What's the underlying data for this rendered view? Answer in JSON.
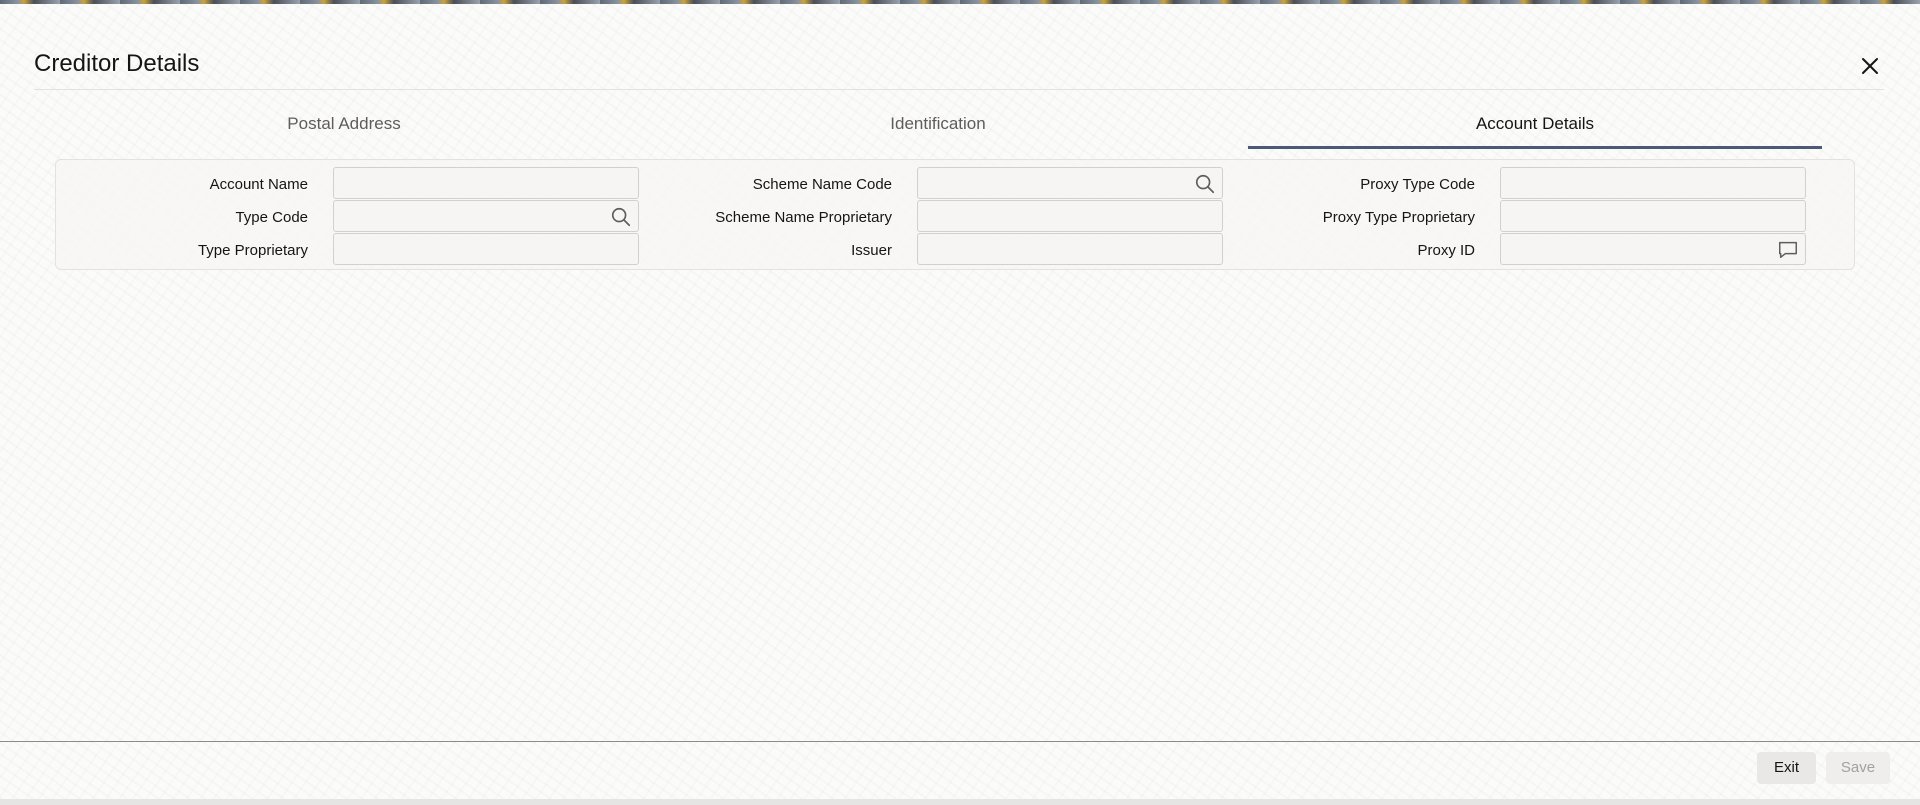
{
  "dialog": {
    "title": "Creditor Details",
    "close_icon": "close-icon"
  },
  "tabs": [
    {
      "label": "Postal Address",
      "active": false
    },
    {
      "label": "Identification",
      "active": false
    },
    {
      "label": "Account Details",
      "active": true
    }
  ],
  "form": {
    "col1": {
      "account_name": {
        "label": "Account Name",
        "value": ""
      },
      "type_code": {
        "label": "Type Code",
        "value": "",
        "icon": "search-icon"
      },
      "type_proprietary": {
        "label": "Type Proprietary",
        "value": ""
      }
    },
    "col2": {
      "scheme_name_code": {
        "label": "Scheme Name Code",
        "value": "",
        "icon": "search-icon"
      },
      "scheme_name_proprietary": {
        "label": "Scheme Name Proprietary",
        "value": ""
      },
      "issuer": {
        "label": "Issuer",
        "value": ""
      }
    },
    "col3": {
      "proxy_type_code": {
        "label": "Proxy Type Code",
        "value": ""
      },
      "proxy_type_proprietary": {
        "label": "Proxy Type Proprietary",
        "value": ""
      },
      "proxy_id": {
        "label": "Proxy ID",
        "value": "",
        "icon": "comment-icon"
      }
    }
  },
  "footer": {
    "exit_label": "Exit",
    "save_label": "Save"
  },
  "colors": {
    "tab_underline": "#4c5a78",
    "text": "#161513",
    "disabled_text": "#a3a19e"
  }
}
